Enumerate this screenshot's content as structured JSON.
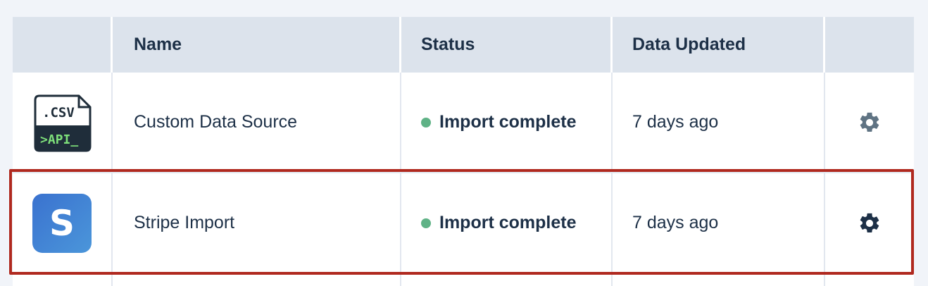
{
  "table": {
    "columns": {
      "icon": "",
      "name": "Name",
      "status": "Status",
      "data_updated": "Data Updated",
      "actions": ""
    },
    "rows": [
      {
        "icon": "csv-api-file-icon",
        "icon_text_top": ".CSV",
        "icon_text_bottom": ">API_",
        "name": "Custom Data Source",
        "status": "Import complete",
        "updated": "7 days ago",
        "action_icon": "gear-icon"
      },
      {
        "icon": "stripe-logo-icon",
        "icon_text": "S",
        "name": "Stripe Import",
        "status": "Import complete",
        "updated": "7 days ago",
        "action_icon": "gear-icon",
        "selected": true
      }
    ]
  },
  "colors": {
    "header_bg": "#dce3ec",
    "status_ok": "#5fb286",
    "selection_outline": "#b0291f",
    "gear_muted": "#5f7383",
    "gear_active": "#1d3047"
  }
}
